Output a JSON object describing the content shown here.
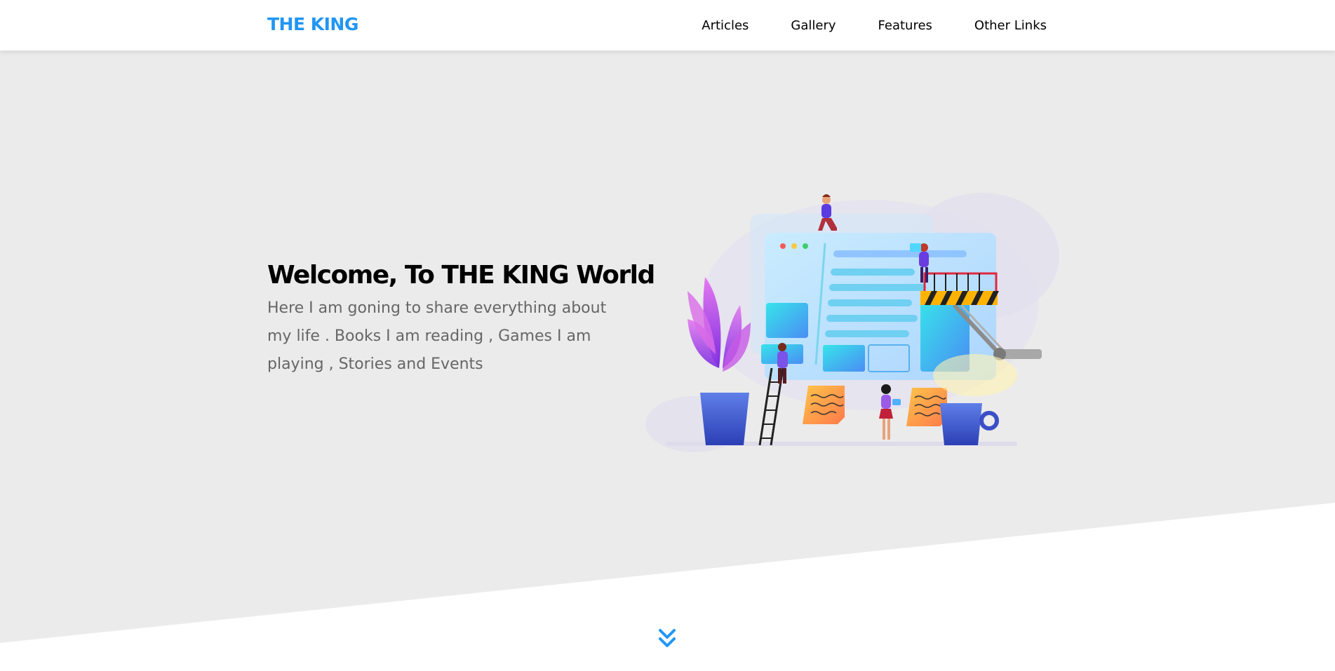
{
  "header": {
    "logo": "THE KING",
    "nav": [
      {
        "label": "Articles"
      },
      {
        "label": "Gallery"
      },
      {
        "label": "Features"
      },
      {
        "label": "Other Links"
      }
    ]
  },
  "hero": {
    "title": "Welcome, To THE KING World",
    "text": "Here I am goning to share everything about my life . Books I am reading , Games I am playing , Stories and Events"
  },
  "colors": {
    "brand": "#2196f3",
    "hero_bg": "#ebebeb"
  },
  "icons": {
    "scroll": "double-chevron-down-icon"
  }
}
